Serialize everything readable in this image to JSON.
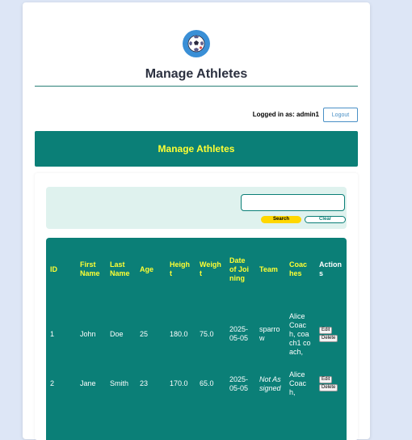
{
  "header": {
    "title": "Manage Athletes",
    "logo_icon": "soccer-ball-icon"
  },
  "session": {
    "logged_in_text": "Logged in as: admin1",
    "logout_label": "Logout"
  },
  "banner": {
    "title": "Manage Athletes"
  },
  "search": {
    "value": "",
    "placeholder": "",
    "search_label": "Search",
    "clear_label": "Clear"
  },
  "table": {
    "headers": [
      "ID",
      "First Name",
      "Last Name",
      "Age",
      "Height",
      "Weight",
      "Date of Joining",
      "Team",
      "Coaches",
      "Actions"
    ],
    "rows": [
      {
        "id": "1",
        "first_name": "John",
        "last_name": "Doe",
        "age": "25",
        "height": "180.0",
        "weight": "75.0",
        "date_of_joining": "2025-05-05",
        "team": "sparrow",
        "coaches": "Alice Coach, coach1 coach,",
        "edit_label": "Edit",
        "delete_label": "Delete"
      },
      {
        "id": "2",
        "first_name": "Jane",
        "last_name": "Smith",
        "age": "23",
        "height": "170.0",
        "weight": "65.0",
        "date_of_joining": "2025-05-05",
        "team": "Not Assigned",
        "coaches": "Alice Coach,",
        "edit_label": "Edit",
        "delete_label": "Delete"
      }
    ]
  },
  "colors": {
    "primary": "#0b7f77",
    "accent_yellow": "#ffff33",
    "button_yellow": "#ffd700",
    "background": "#dde6f6"
  }
}
